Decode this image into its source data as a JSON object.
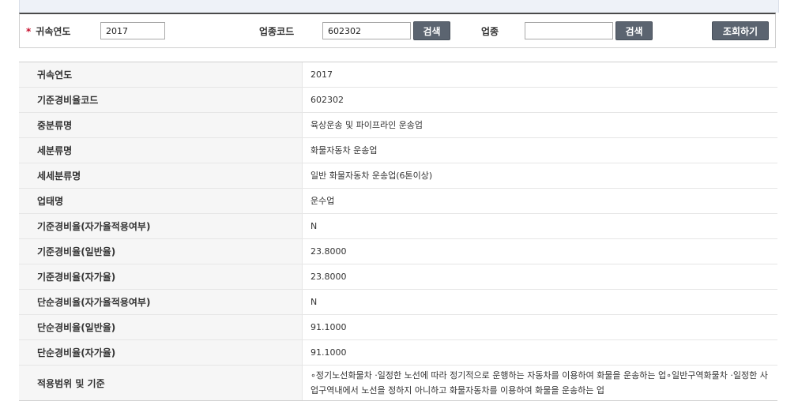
{
  "search": {
    "year_label": "귀속연도",
    "year_value": "2017",
    "code_label": "업종코드",
    "code_value": "602302",
    "search_btn_label": "검색",
    "industry_label": "업종",
    "industry_value": "",
    "search_btn2_label": "검색",
    "query_btn_label": "조회하기"
  },
  "details": [
    {
      "label": "귀속연도",
      "value": "2017"
    },
    {
      "label": "기준경비율코드",
      "value": "602302"
    },
    {
      "label": "중분류명",
      "value": "육상운송 및 파이프라인 운송업"
    },
    {
      "label": "세분류명",
      "value": "화물자동차 운송업"
    },
    {
      "label": "세세분류명",
      "value": "일반 화물자동차 운송업(6톤이상)"
    },
    {
      "label": "업태명",
      "value": "운수업"
    },
    {
      "label": "기준경비율(자가율적용여부)",
      "value": "N"
    },
    {
      "label": "기준경비율(일반율)",
      "value": "23.8000"
    },
    {
      "label": "기준경비율(자가율)",
      "value": "23.8000"
    },
    {
      "label": "단순경비율(자가율적용여부)",
      "value": "N"
    },
    {
      "label": "단순경비율(일반율)",
      "value": "91.1000"
    },
    {
      "label": "단순경비율(자가율)",
      "value": "91.1000"
    },
    {
      "label": "적용범위 및 기준",
      "value": "∘정기노선화물차 ·일정한 노선에 따라 정기적으로 운행하는 자동차를 이용하여 화물을 운송하는 업∘일반구역화물차 ·일정한 사업구역내에서 노선을 정하지 아니하고 화물자동차를 이용하여 화물을 운송하는 업"
    }
  ]
}
